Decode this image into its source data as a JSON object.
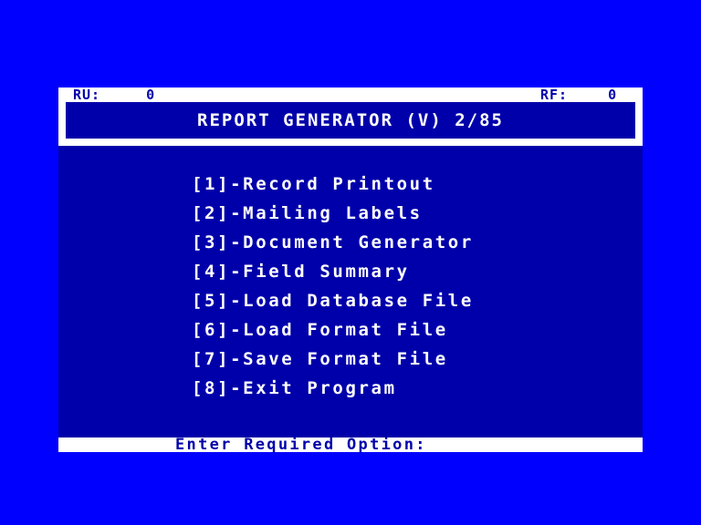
{
  "header": {
    "ru_label": "RU:",
    "ru_value": "0",
    "rf_label": "RF:",
    "rf_value": "0",
    "title": "REPORT GENERATOR (V) 2/85"
  },
  "menu": {
    "items": [
      {
        "key": "1",
        "label": "[1]-Record Printout"
      },
      {
        "key": "2",
        "label": "[2]-Mailing Labels"
      },
      {
        "key": "3",
        "label": "[3]-Document Generator"
      },
      {
        "key": "4",
        "label": "[4]-Field Summary"
      },
      {
        "key": "5",
        "label": "[5]-Load Database File"
      },
      {
        "key": "6",
        "label": "[6]-Load Format File"
      },
      {
        "key": "7",
        "label": "[7]-Save Format File"
      },
      {
        "key": "8",
        "label": "[8]-Exit Program"
      }
    ]
  },
  "prompt": {
    "text": "Enter Required Option:"
  },
  "colors": {
    "border": "#0000ff",
    "panel": "#0000aa",
    "text": "#ffffff"
  }
}
